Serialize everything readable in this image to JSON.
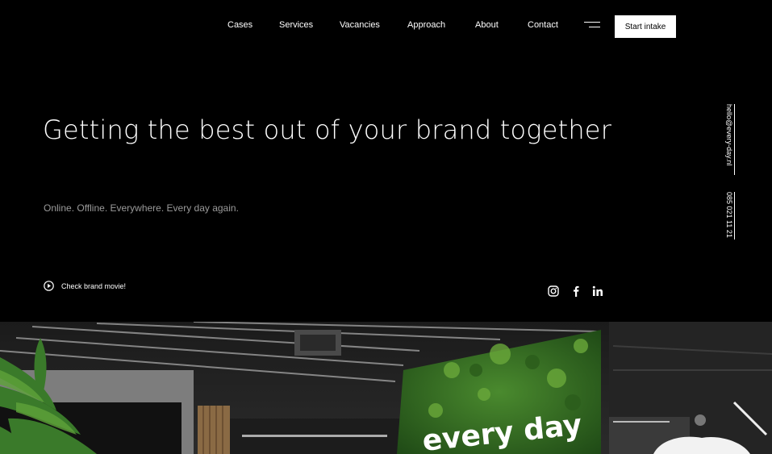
{
  "nav": {
    "links": [
      "Cases",
      "Services",
      "Vacancies",
      "Approach",
      "About",
      "Contact"
    ],
    "cta_label": "Start intake",
    "menu_icon": "hamburger-icon"
  },
  "hero": {
    "headline": "Getting the best out of your brand together",
    "tagline": "Online. Offline. Everywhere. Every day again.",
    "movie_label": "Check brand movie!",
    "movie_icon": "play-icon"
  },
  "side": {
    "email": "hello@every-day.nl",
    "phone": "085 021 11 21"
  },
  "social": [
    "instagram-icon",
    "facebook-icon",
    "linkedin-icon"
  ],
  "photo": {
    "sign_text": "every day"
  },
  "colors": {
    "background": "#000000",
    "text": "#ffffff",
    "muted": "#9a9a9a",
    "moss": "#3f7a2a"
  }
}
